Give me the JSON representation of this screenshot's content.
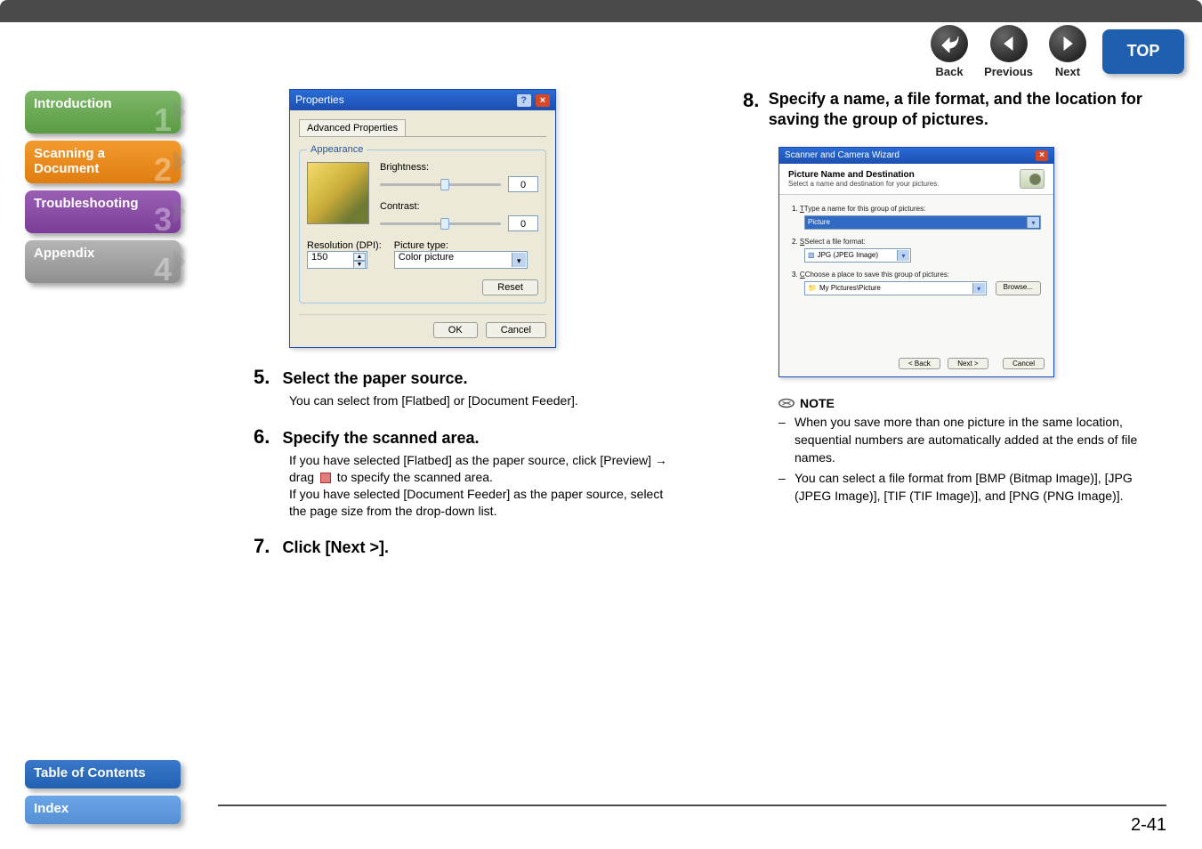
{
  "topnav": {
    "back": "Back",
    "previous": "Previous",
    "next": "Next",
    "top": "TOP"
  },
  "sidebar": {
    "intro": {
      "label": "Introduction",
      "num": "1"
    },
    "scan": {
      "label": "Scanning a Document",
      "num": "2"
    },
    "tshoot": {
      "label": "Troubleshooting",
      "num": "3"
    },
    "app": {
      "label": "Appendix",
      "num": "4"
    },
    "toc": "Table of Contents",
    "index": "Index"
  },
  "dialog1": {
    "title": "Properties",
    "tab": "Advanced Properties",
    "legend": "Appearance",
    "brightness_lbl": "Brightness:",
    "brightness_val": "0",
    "contrast_lbl": "Contrast:",
    "contrast_val": "0",
    "res_lbl": "Resolution (DPI):",
    "res_val": "150",
    "pictype_lbl": "Picture type:",
    "pictype_val": "Color picture",
    "reset": "Reset",
    "ok": "OK",
    "cancel": "Cancel"
  },
  "steps": {
    "s5_num": "5.",
    "s5_head": "Select the paper source.",
    "s5_body": "You can select from [Flatbed] or [Document Feeder].",
    "s6_num": "6.",
    "s6_head": "Specify the scanned area.",
    "s6_body1a": "If you have selected [Flatbed] as the paper source, click [Preview] → drag ",
    "s6_body1b": " to specify the scanned area.",
    "s6_body2": "If you have selected [Document Feeder] as the paper source, select the page size from the drop-down list.",
    "s7_num": "7.",
    "s7_head": "Click [Next >].",
    "s8_num": "8.",
    "s8_head": "Specify a name, a file format, and the location for saving the group of pictures."
  },
  "wizard": {
    "title": "Scanner and Camera Wizard",
    "head_bold": "Picture Name and Destination",
    "head_sub": "Select a name and destination for your pictures.",
    "l1": "Type a name for this group of pictures:",
    "v1": "Picture",
    "l2": "Select a file format:",
    "v2": "JPG (JPEG Image)",
    "l3": "Choose a place to save this group of pictures:",
    "v3": "My Pictures\\Picture",
    "browse": "Browse...",
    "back": "< Back",
    "next": "Next >",
    "cancel": "Cancel"
  },
  "note": {
    "title": "NOTE",
    "n1": "When you save more than one picture in the same location, sequential numbers are automatically added at the ends of file names.",
    "n2": "You can select a file format from [BMP (Bitmap Image)], [JPG (JPEG Image)], [TIF (TIF Image)], and [PNG (PNG Image)]."
  },
  "pagefoot": "2-41"
}
